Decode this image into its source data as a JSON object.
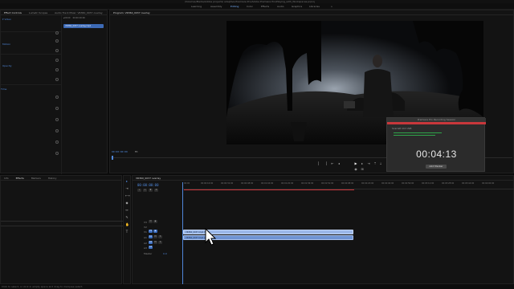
{
  "titlebar": {
    "path": "/Volumes/Media/Adobe projects/ adaptive-Premiere Pro/Adobe Premiere Pro/Playing_with_Workspaces.prproj"
  },
  "workspaces": {
    "items": [
      "Learning",
      "Assembly",
      "Editing",
      "Color",
      "Effects",
      "Audio",
      "Graphics",
      "Libraries"
    ],
    "active": "Editing"
  },
  "source_panel": {
    "tabs": [
      "Effect Controls",
      "Lumetri Scopes",
      "Audio Track Mixer: VR360_0037 overlay"
    ],
    "active_tab": "Effect Controls",
    "selected_clip": "VR360_0037 overlay.mp4"
  },
  "program_panel": {
    "title": "Program: VR360_0037 overlay",
    "timecode": "00:00:00:00",
    "fit": "Fit"
  },
  "recording_overlay": {
    "title": "Premiere Pro Recording Session",
    "status": "Scarlett 2i2 USB",
    "timer": "00:04:13",
    "button": "Add Marker",
    "accent": "#c8373b",
    "meter_color": "#2fa44a"
  },
  "project_panel": {
    "tabs": [
      "Info",
      "Effects",
      "Markers",
      "History"
    ],
    "active_tab": "Effects"
  },
  "timeline": {
    "tab": "VR360_0037 overlay",
    "timecode": "00:00:00:00",
    "ruler": [
      "00:00",
      "00:00:16:00",
      "00:00:32:00",
      "00:00:48:00",
      "00:01:04:00",
      "00:01:20:00",
      "00:01:36:00",
      "00:01:52:00",
      "00:02:08:00",
      "00:02:24:00",
      "00:02:40:00",
      "00:02:56:00",
      "00:03:12:00",
      "00:03:28:00",
      "00:03:44:00",
      "00:04:00:00"
    ],
    "tracks": [
      "V3",
      "V2",
      "V1",
      "A1",
      "A2",
      "A3",
      "Master"
    ],
    "master_value": "0.0",
    "clip_video": "VR360_0037.mp4 [V]",
    "clip_audio": "VR360_0037.mp4 [A]",
    "clip_color": "#9ab7e8"
  },
  "statusbar": {
    "hint": "Click to select, or click in empty space and drag to marquee select."
  }
}
